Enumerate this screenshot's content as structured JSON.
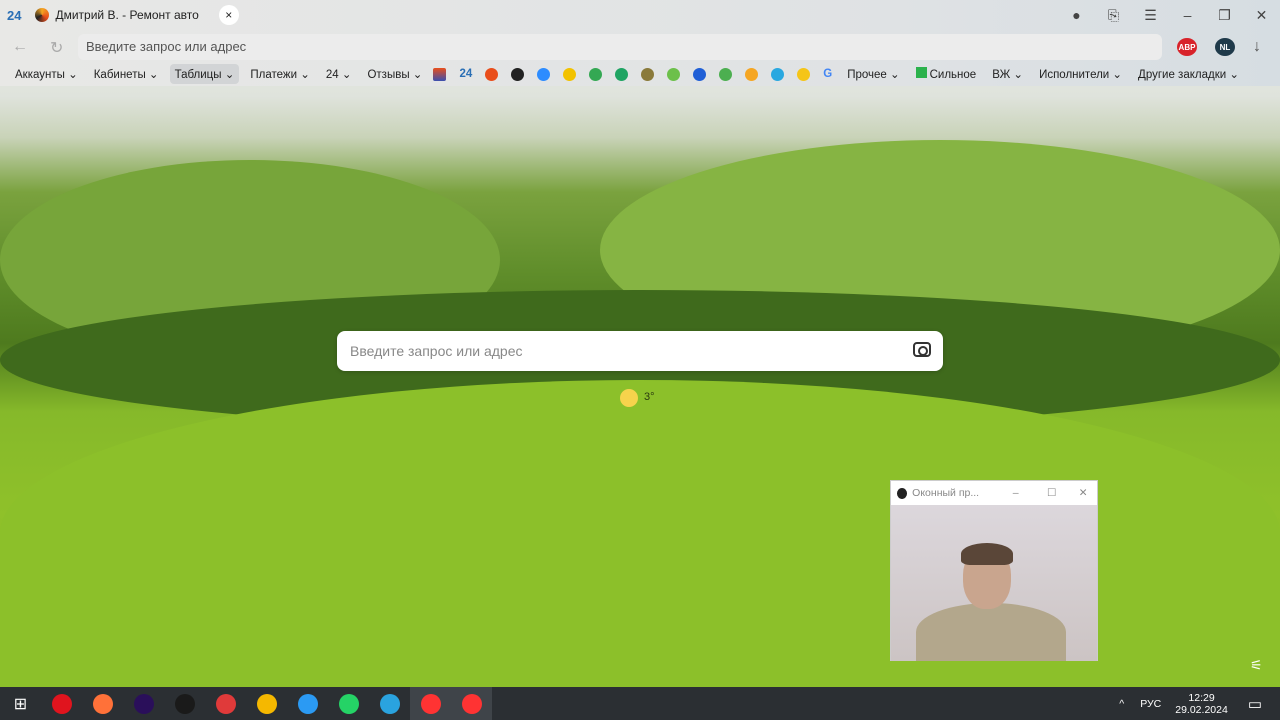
{
  "tabs": {
    "counter": "24",
    "active_title": "Дмитрий В. - Ремонт авто",
    "close": "×"
  },
  "window": {
    "minimize": "–",
    "restore": "❐",
    "close": "✕",
    "menu": "☰"
  },
  "address": {
    "placeholder": "Введите запрос или адрес"
  },
  "bookmarks": {
    "folders": [
      "Аккаунты ⌄",
      "Кабинеты ⌄",
      "Таблицы ⌄",
      "Платежи ⌄",
      "24 ⌄",
      "Отзывы ⌄"
    ],
    "icon_24": "24",
    "more": [
      "Прочее ⌄",
      "Сильное",
      "ВЖ ⌄",
      "Исполнители ⌄"
    ],
    "other": "Другие закладки ⌄",
    "icon_colors": [
      "#e94e1b",
      "#222",
      "#2d8cff",
      "#f2c200",
      "#34a853",
      "#1fa463",
      "#8a7a3a",
      "#6cc04a",
      "#1f5fd6",
      "#4caf50",
      "#f5a623",
      "#29a8e0",
      "#f5c518"
    ],
    "google": "G"
  },
  "extensions": {
    "abp": "ABP",
    "nl": "NL"
  },
  "main_search": {
    "placeholder": "Введите запрос или адрес"
  },
  "weather": {
    "temp": "3°"
  },
  "pip": {
    "title": "Оконный пр...",
    "minimize": "–",
    "maximize": "☐",
    "close": "✕"
  },
  "tray": {
    "lang": "РУС",
    "time": "12:29",
    "date": "29.02.2024",
    "chevron": "^"
  },
  "taskbar_colors": [
    "#e0141e",
    "#ff7139",
    "#2a0f5a",
    "#1a1a1a",
    "#e03a3a",
    "#f5b800",
    "#2b9af3",
    "#25d366",
    "#2aa3df",
    "#ff3333",
    "#ff3333"
  ]
}
